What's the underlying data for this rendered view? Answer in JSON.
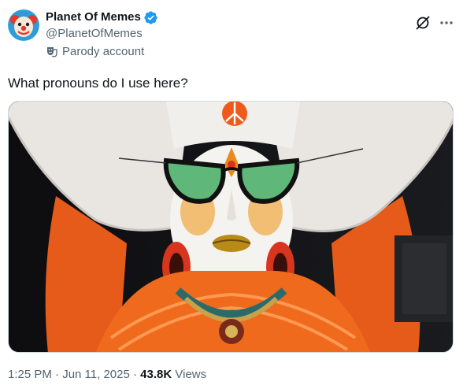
{
  "tweet": {
    "author": {
      "display_name": "Planet Of Memes",
      "handle": "@PlanetOfMemes",
      "verified": true,
      "account_label": "Parody account",
      "avatar_icon": "clown-avatar"
    },
    "text": "What pronouns do I use here?",
    "media": {
      "type": "video-frame",
      "description_icon": "video-thumbnail"
    },
    "timestamp": "1:25 PM · Jun 11, 2025",
    "views_count": "43.8K",
    "views_label": "Views"
  },
  "colors": {
    "verified_blue": "#1d9bf0",
    "secondary_text": "#536471",
    "primary_text": "#0f1419"
  }
}
